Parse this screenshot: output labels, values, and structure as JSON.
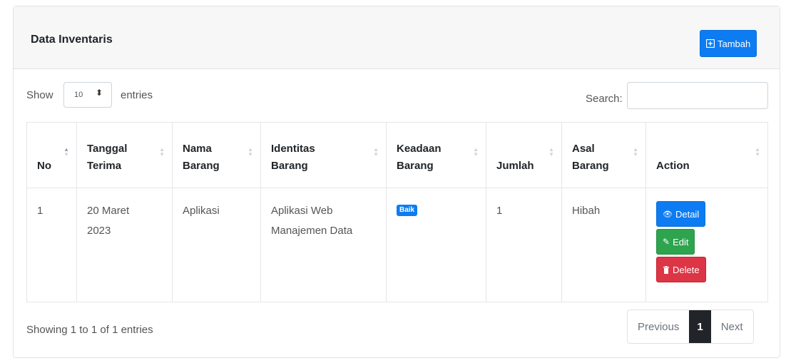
{
  "card": {
    "title": "Data Inventaris",
    "add_button_label": "Tambah",
    "add_button_icon": "plus-square-icon"
  },
  "controls": {
    "show_label": "Show",
    "page_size": "10",
    "entries_label": "entries",
    "search_label": "Search:",
    "search_value": ""
  },
  "table": {
    "headers": [
      "No",
      "Tanggal Terima",
      "Nama Barang",
      "Identitas Barang",
      "Keadaan Barang",
      "Jumlah",
      "Asal Barang",
      "Action"
    ],
    "header_lines": {
      "tanggal": [
        "Tanggal",
        "Terima"
      ],
      "nama": [
        "Nama",
        "Barang"
      ],
      "identitas": [
        "Identitas",
        "Barang"
      ],
      "keadaan": [
        "Keadaan",
        "Barang"
      ],
      "asal": [
        "Asal",
        "Barang"
      ]
    },
    "rows": [
      {
        "no": "1",
        "tanggal": [
          "20 Maret",
          "2023"
        ],
        "nama": "Aplikasi",
        "identitas": [
          "Aplikasi Web",
          "Manajemen Data"
        ],
        "keadaan": "Baik",
        "jumlah": "1",
        "asal": "Hibah",
        "actions": {
          "detail": "Detail",
          "edit": "Edit",
          "delete": "Delete"
        }
      }
    ]
  },
  "footer": {
    "info": "Showing 1 to 1 of 1 entries",
    "previous": "Previous",
    "current_page": "1",
    "next": "Next"
  },
  "colors": {
    "primary": "#0d7cf2",
    "success": "#2ea44f",
    "danger": "#dc3545",
    "arrow": "#e8141b"
  }
}
